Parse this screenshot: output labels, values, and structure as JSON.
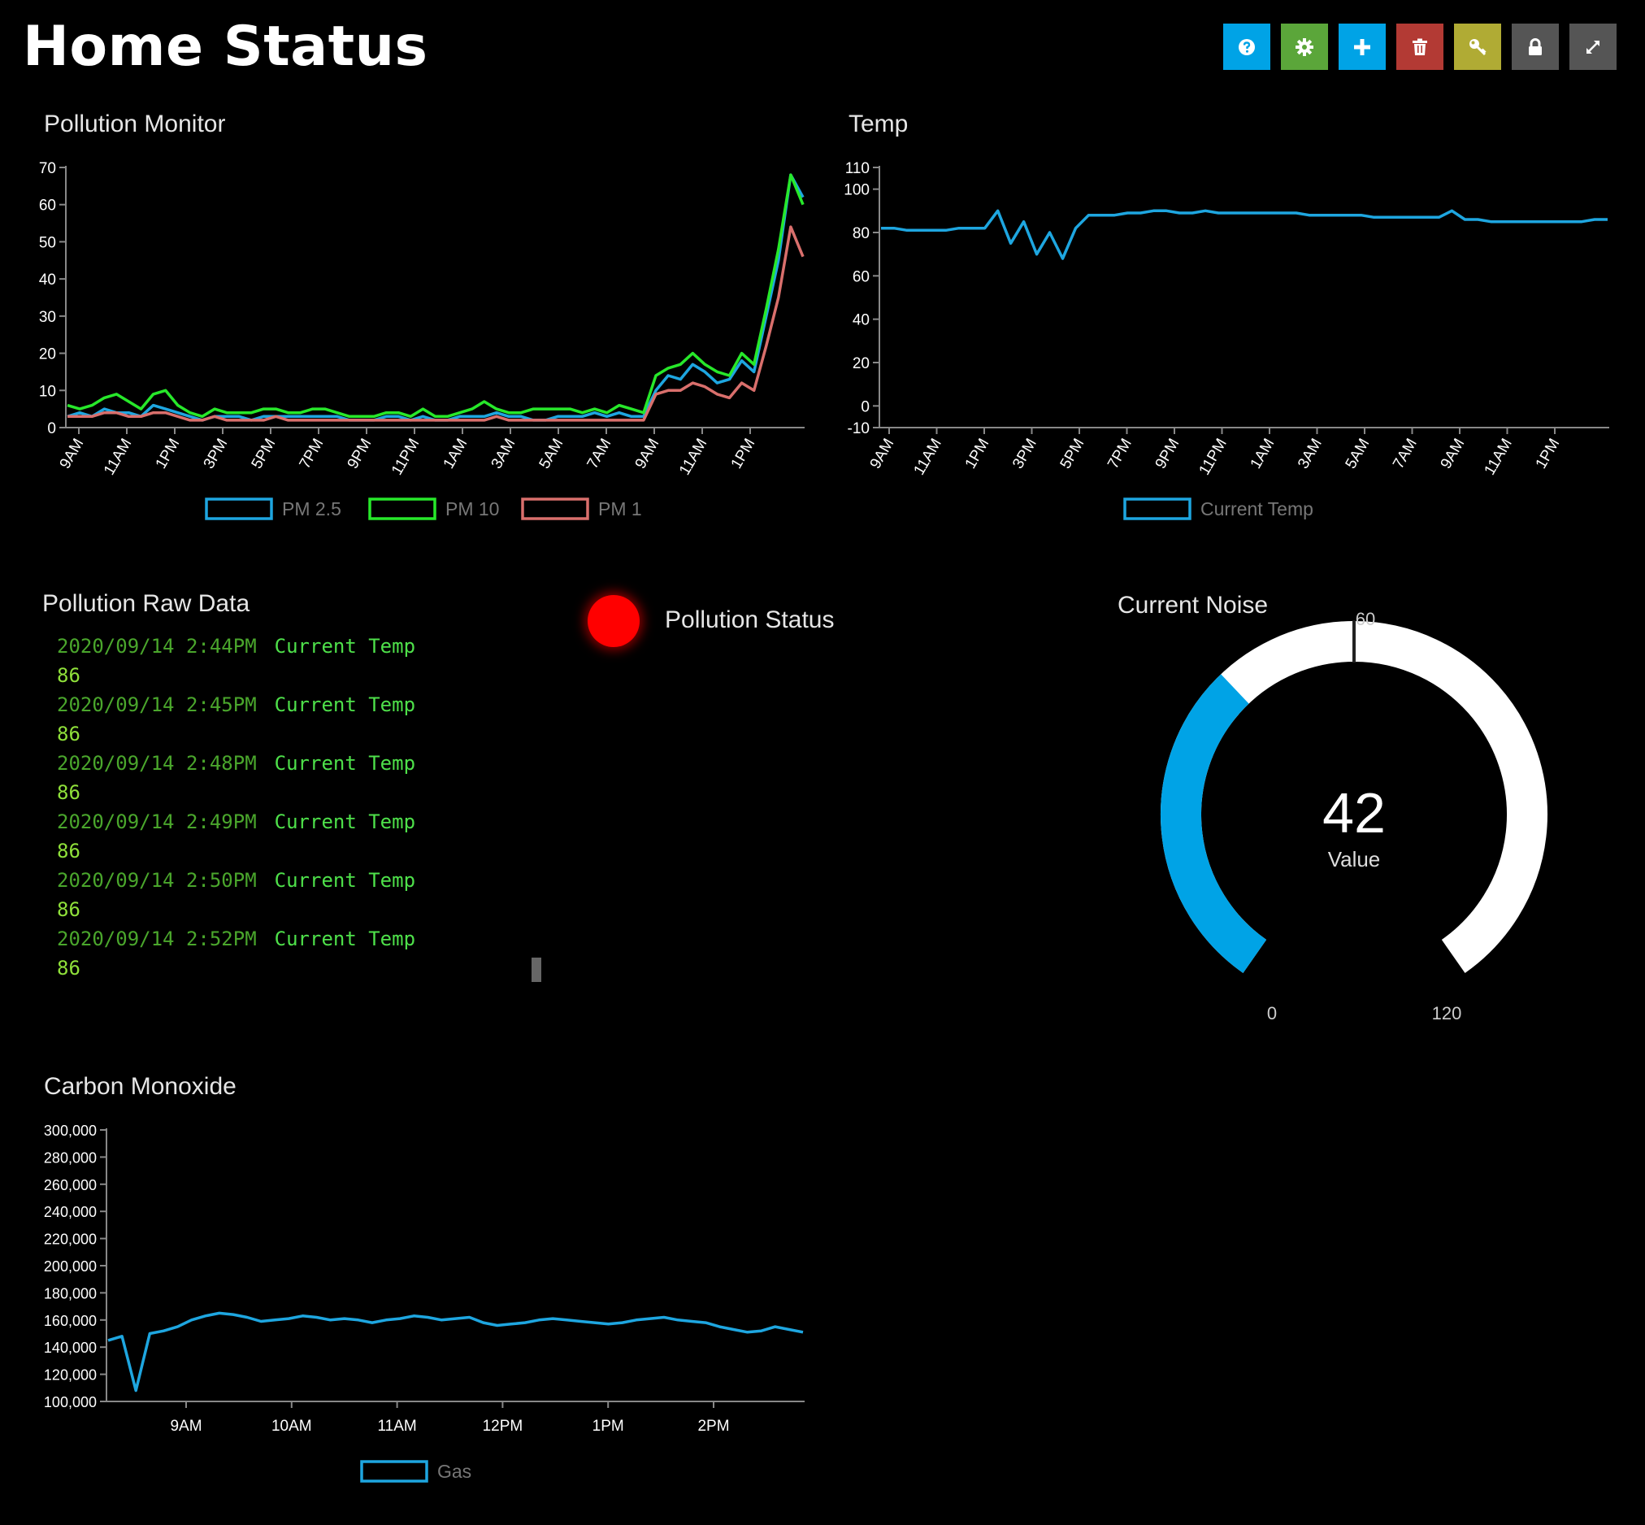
{
  "page": {
    "title": "Home Status"
  },
  "toolbar": {
    "buttons": [
      {
        "name": "help-button",
        "icon": "help-icon",
        "color": "#00a3e6"
      },
      {
        "name": "settings-button",
        "icon": "gear-icon",
        "color": "#5ba63a"
      },
      {
        "name": "add-button",
        "icon": "plus-icon",
        "color": "#00a3e6"
      },
      {
        "name": "delete-button",
        "icon": "trash-icon",
        "color": "#b33a34"
      },
      {
        "name": "key-button",
        "icon": "key-icon",
        "color": "#b0ab34"
      },
      {
        "name": "lock-button",
        "icon": "lock-icon",
        "color": "#555555"
      },
      {
        "name": "fullscreen-button",
        "icon": "expand-icon",
        "color": "#555555"
      }
    ]
  },
  "pollution_monitor": {
    "title": "Pollution Monitor"
  },
  "temp": {
    "title": "Temp"
  },
  "raw_data": {
    "title": "Pollution Raw Data",
    "rows": [
      {
        "timestamp": "2020/09/14 2:44PM",
        "label": "Current Temp",
        "value": "86"
      },
      {
        "timestamp": "2020/09/14 2:45PM",
        "label": "Current Temp",
        "value": "86"
      },
      {
        "timestamp": "2020/09/14 2:48PM",
        "label": "Current Temp",
        "value": "86"
      },
      {
        "timestamp": "2020/09/14 2:49PM",
        "label": "Current Temp",
        "value": "86"
      },
      {
        "timestamp": "2020/09/14 2:50PM",
        "label": "Current Temp",
        "value": "86"
      },
      {
        "timestamp": "2020/09/14 2:52PM",
        "label": "Current Temp",
        "value": "86"
      }
    ]
  },
  "status": {
    "label": "Pollution Status",
    "color": "#ff0000"
  },
  "noise": {
    "title": "Current Noise",
    "value": 42,
    "value_text": "42",
    "unit_label": "Value",
    "min": "0",
    "max": "120",
    "mid": "60",
    "fill_color": "#00a3e6"
  },
  "carbon": {
    "title": "Carbon Monoxide"
  },
  "chart_data": [
    {
      "type": "line",
      "ylim": [
        0,
        70
      ],
      "yticks": [
        "0",
        "10",
        "20",
        "30",
        "40",
        "50",
        "60",
        "70"
      ],
      "xticks": [
        "9AM",
        "11AM",
        "1PM",
        "3PM",
        "5PM",
        "7PM",
        "9PM",
        "11PM",
        "1AM",
        "3AM",
        "5AM",
        "7AM",
        "9AM",
        "11AM",
        "1PM"
      ],
      "series": [
        {
          "name": "PM 2.5",
          "color": "#1ea6e0",
          "values": [
            3,
            4,
            3,
            5,
            4,
            4,
            3,
            6,
            5,
            4,
            3,
            2,
            3,
            3,
            3,
            2,
            3,
            3,
            3,
            3,
            3,
            3,
            3,
            2,
            2,
            2,
            3,
            3,
            2,
            3,
            2,
            2,
            3,
            3,
            3,
            4,
            3,
            3,
            2,
            2,
            3,
            3,
            3,
            4,
            3,
            4,
            3,
            3,
            10,
            14,
            13,
            17,
            15,
            12,
            13,
            18,
            15,
            30,
            45,
            68,
            62
          ]
        },
        {
          "name": "PM 10",
          "color": "#27e82a",
          "values": [
            6,
            5,
            6,
            8,
            9,
            7,
            5,
            9,
            10,
            6,
            4,
            3,
            5,
            4,
            4,
            4,
            5,
            5,
            4,
            4,
            5,
            5,
            4,
            3,
            3,
            3,
            4,
            4,
            3,
            5,
            3,
            3,
            4,
            5,
            7,
            5,
            4,
            4,
            5,
            5,
            5,
            5,
            4,
            5,
            4,
            6,
            5,
            4,
            14,
            16,
            17,
            20,
            17,
            15,
            14,
            20,
            17,
            32,
            48,
            68,
            60
          ]
        },
        {
          "name": "PM 1",
          "color": "#d96f6c",
          "values": [
            3,
            3,
            3,
            4,
            4,
            3,
            3,
            4,
            4,
            3,
            2,
            2,
            3,
            2,
            2,
            2,
            2,
            3,
            2,
            2,
            2,
            2,
            2,
            2,
            2,
            2,
            2,
            2,
            2,
            2,
            2,
            2,
            2,
            2,
            2,
            3,
            2,
            2,
            2,
            2,
            2,
            2,
            2,
            2,
            2,
            2,
            2,
            2,
            9,
            10,
            10,
            12,
            11,
            9,
            8,
            12,
            10,
            22,
            35,
            54,
            46
          ]
        }
      ]
    },
    {
      "type": "line",
      "ylim": [
        -10,
        110
      ],
      "yticks": [
        "-10",
        "0",
        "20",
        "40",
        "60",
        "80",
        "100",
        "110"
      ],
      "xticks": [
        "9AM",
        "11AM",
        "1PM",
        "3PM",
        "5PM",
        "7PM",
        "9PM",
        "11PM",
        "1AM",
        "3AM",
        "5AM",
        "7AM",
        "9AM",
        "11AM",
        "1PM"
      ],
      "series": [
        {
          "name": "Current Temp",
          "color": "#1ea6e0",
          "values": [
            82,
            82,
            81,
            81,
            81,
            81,
            82,
            82,
            82,
            90,
            75,
            85,
            70,
            80,
            68,
            82,
            88,
            88,
            88,
            89,
            89,
            90,
            90,
            89,
            89,
            90,
            89,
            89,
            89,
            89,
            89,
            89,
            89,
            88,
            88,
            88,
            88,
            88,
            87,
            87,
            87,
            87,
            87,
            87,
            90,
            86,
            86,
            85,
            85,
            85,
            85,
            85,
            85,
            85,
            85,
            86,
            86
          ]
        }
      ]
    },
    {
      "type": "line",
      "ylim": [
        100000,
        300000
      ],
      "yticks": [
        "100,000",
        "120,000",
        "140,000",
        "160,000",
        "180,000",
        "200,000",
        "220,000",
        "240,000",
        "260,000",
        "280,000",
        "300,000"
      ],
      "xticks": [
        "9AM",
        "10AM",
        "11AM",
        "12PM",
        "1PM",
        "2PM"
      ],
      "series": [
        {
          "name": "Gas",
          "color": "#1ea6e0",
          "values": [
            145,
            148,
            108,
            150,
            152,
            155,
            160,
            163,
            165,
            164,
            162,
            159,
            160,
            161,
            163,
            162,
            160,
            161,
            160,
            158,
            160,
            161,
            163,
            162,
            160,
            161,
            162,
            158,
            156,
            157,
            158,
            160,
            161,
            160,
            159,
            158,
            157,
            158,
            160,
            161,
            162,
            160,
            159,
            158,
            155,
            153,
            151,
            152,
            155,
            153,
            151
          ]
        }
      ]
    }
  ]
}
